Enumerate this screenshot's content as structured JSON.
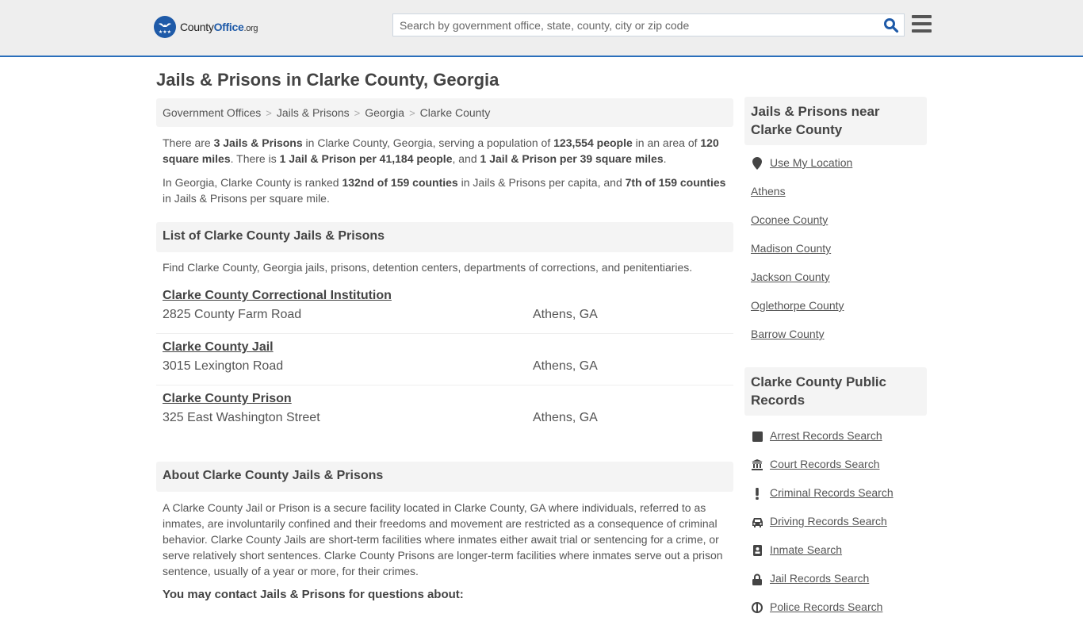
{
  "header": {
    "logo": {
      "county": "County",
      "office": "Office",
      "org": ".org"
    },
    "search_placeholder": "Search by government office, state, county, city or zip code",
    "search_icon": "search-icon",
    "menu_icon": "hamburger-menu-icon",
    "accent_color": "#2a6ebb"
  },
  "page_title": "Jails & Prisons in Clarke County, Georgia",
  "breadcrumb": [
    "Government Offices",
    "Jails & Prisons",
    "Georgia",
    "Clarke County"
  ],
  "intro": {
    "p1": {
      "t1": "There are ",
      "b1": "3 Jails & Prisons",
      "t2": " in Clarke County, Georgia, serving a population of ",
      "b2": "123,554 people",
      "t3": " in an area of ",
      "b3": "120 square miles",
      "t4": ". There is ",
      "b4": "1 Jail & Prison per 41,184 people",
      "t5": ", and ",
      "b5": "1 Jail & Prison per 39 square miles",
      "t6": "."
    },
    "p2": {
      "t1": "In Georgia, Clarke County is ranked ",
      "b1": "132nd of 159 counties",
      "t2": " in Jails & Prisons per capita, and ",
      "b2": "7th of 159 counties",
      "t3": " in Jails & Prisons per square mile."
    }
  },
  "list_section": {
    "heading": "List of Clarke County Jails & Prisons",
    "description": "Find Clarke County, Georgia jails, prisons, detention centers, departments of corrections, and penitentiaries.",
    "items": [
      {
        "name": "Clarke County Correctional Institution",
        "address": "2825 County Farm Road",
        "city": "Athens, GA"
      },
      {
        "name": "Clarke County Jail",
        "address": "3015 Lexington Road",
        "city": "Athens, GA"
      },
      {
        "name": "Clarke County Prison",
        "address": "325 East Washington Street",
        "city": "Athens, GA"
      }
    ]
  },
  "about_section": {
    "heading": "About Clarke County Jails & Prisons",
    "body": "A Clarke County Jail or Prison is a secure facility located in Clarke County, GA where individuals, referred to as inmates, are involuntarily confined and their freedoms and movement are restricted as a consequence of criminal behavior. Clarke County Jails are short-term facilities where inmates either await trial or sentencing for a crime, or serve relatively short sentences. Clarke County Prisons are longer-term facilities where inmates serve out a prison sentence, usually of a year or more, for their crimes.",
    "contact_heading": "You may contact Jails & Prisons for questions about:"
  },
  "sidebar": {
    "nearby": {
      "heading": "Jails & Prisons near Clarke County",
      "use_location": "Use My Location",
      "links": [
        "Athens",
        "Oconee County",
        "Madison County",
        "Jackson County",
        "Oglethorpe County",
        "Barrow County"
      ]
    },
    "records": {
      "heading": "Clarke County Public Records",
      "links": [
        {
          "label": "Arrest Records Search",
          "icon": "arrest-record-icon"
        },
        {
          "label": "Court Records Search",
          "icon": "courthouse-icon"
        },
        {
          "label": "Criminal Records Search",
          "icon": "exclamation-icon"
        },
        {
          "label": "Driving Records Search",
          "icon": "car-icon"
        },
        {
          "label": "Inmate Search",
          "icon": "id-badge-icon"
        },
        {
          "label": "Jail Records Search",
          "icon": "lock-icon"
        },
        {
          "label": "Police Records Search",
          "icon": "police-badge-icon"
        }
      ]
    }
  }
}
